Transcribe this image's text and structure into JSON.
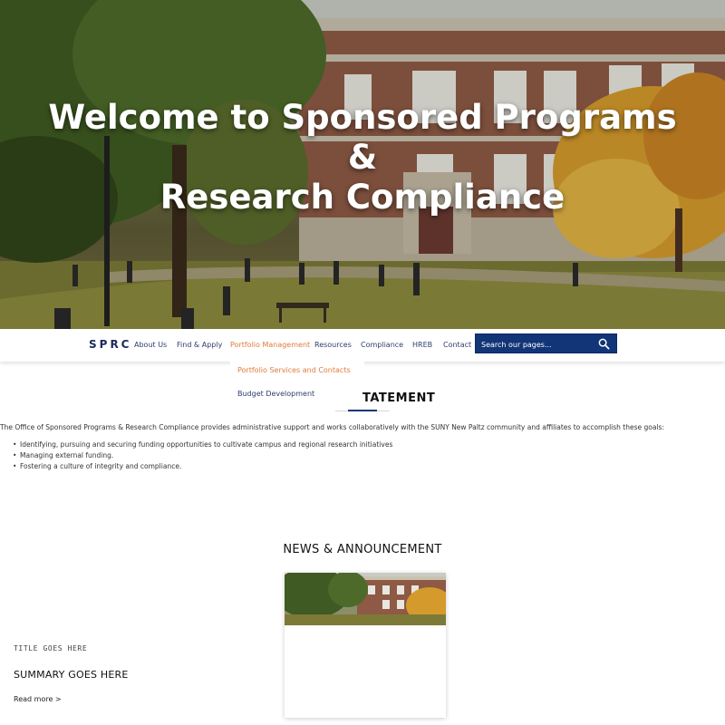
{
  "hero": {
    "title_line1": "Welcome to Sponsored Programs",
    "title_line2": "&",
    "title_line3": "Research Compliance"
  },
  "nav": {
    "brand": "SPRC",
    "items": [
      {
        "label": "About Us"
      },
      {
        "label": "Find & Apply"
      },
      {
        "label": "Portfolio Management"
      },
      {
        "label": "Resources"
      },
      {
        "label": "Compliance"
      },
      {
        "label": "HREB"
      },
      {
        "label": "Contact"
      }
    ],
    "active_item": "Portfolio Management",
    "search_placeholder": "Search our pages..."
  },
  "dropdown": {
    "items": [
      {
        "label": "Portfolio Services and Contacts"
      },
      {
        "label": "Budget Development"
      }
    ]
  },
  "mission": {
    "heading_visible": "TATEMENT",
    "intro": "The Office of Sponsored Programs & Research Compliance provides administrative support and works collaboratively with the SUNY New Paltz community and affiliates to accomplish these goals:",
    "goals": [
      "Identifying, pursuing and securing funding opportunities to cultivate campus and regional research initiatives",
      "Managing external funding.",
      "Fostering a culture of integrity and compliance."
    ]
  },
  "news": {
    "heading": "NEWS & ANNOUNCEMENT",
    "card": {
      "title": "TITLE GOES HERE",
      "summary": "SUMMARY GOES HERE",
      "link": "Read more >"
    }
  },
  "colors": {
    "brand_navy": "#123578",
    "accent_orange": "#e07a3c",
    "nav_text": "#2c3e70"
  },
  "icons": {
    "search": "magnifier-icon"
  }
}
